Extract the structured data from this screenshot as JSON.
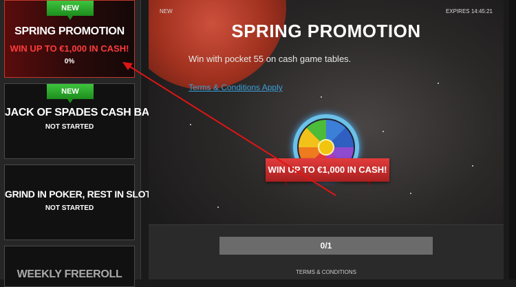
{
  "sidebar": {
    "cards": [
      {
        "ribbon": "NEW",
        "title": "SPRING PROMOTION",
        "prize": "WIN UP TO €1,000 IN CASH!",
        "status": "0%"
      },
      {
        "ribbon": "NEW",
        "title": "JACK OF SPADES CASH BACK",
        "status": "NOT STARTED"
      },
      {
        "title": "GRIND IN POKER, REST IN SLOT...",
        "status": "NOT STARTED"
      },
      {
        "title": "WEEKLY FREEROLL"
      }
    ]
  },
  "main": {
    "tag": "NEW",
    "expires": "EXPIRES 14:45:21",
    "title": "SPRING PROMOTION",
    "description": "Win with pocket 55 on cash game tables.",
    "terms_link": "Terms & Conditions Apply",
    "banner": "WIN UP TO €1,000 IN CASH!",
    "progress": "0/1",
    "footer_terms": "TERMS & CONDITIONS"
  },
  "colors": {
    "accent_red": "#e23c3c",
    "ribbon_green": "#2cb32c",
    "link_blue": "#3aa1d8"
  },
  "icons": [
    "prize-wheel-icon",
    "annotation-arrow"
  ]
}
